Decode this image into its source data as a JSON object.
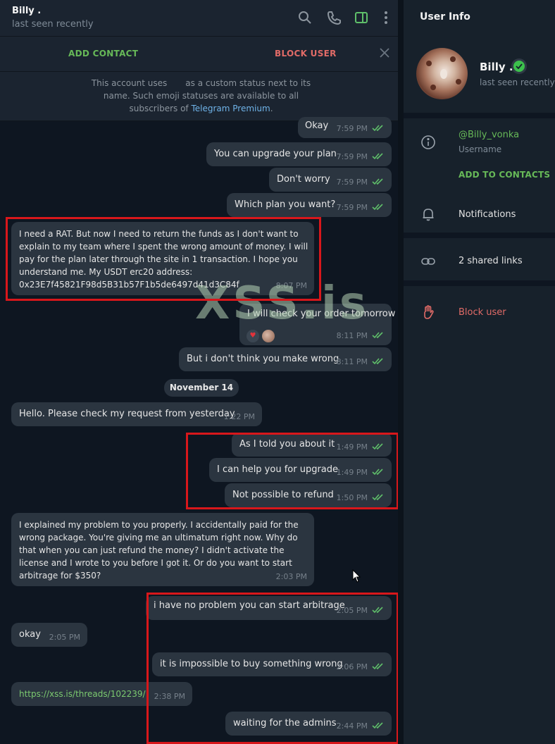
{
  "chat": {
    "name": "Billy .",
    "status": "last seen recently",
    "add_contact": "ADD CONTACT",
    "block_user": "BLOCK USER",
    "premium_note": {
      "line1a": "This account uses",
      "line1b": "as a custom status next to its",
      "line2": "name. Such emoji statuses are available to all",
      "line3a": "subscribers of",
      "link": "Telegram Premium",
      "line3b": "."
    },
    "date_divider": "November 14",
    "watermark": "XSS.is",
    "messages": [
      {
        "dir": "out",
        "text": "Okay",
        "time": "7:59 PM"
      },
      {
        "dir": "out",
        "text": "You can upgrade your plan",
        "time": "7:59 PM"
      },
      {
        "dir": "out",
        "text": "Don't worry",
        "time": "7:59 PM"
      },
      {
        "dir": "out",
        "text": "Which plan you want?",
        "time": "7:59 PM"
      },
      {
        "dir": "in",
        "text": "I need a RAT. But now I need to return the funds as I don't want to\nexplain to my team where I spent the wrong amount of money. I will\npay for the plan later through the site in 1 transaction. I hope you\nunderstand me. My USDT erc20 address:\n0x23E7f45821F98d5B31b57F1b5de6497d41d3C84f",
        "time": "8:07 PM"
      },
      {
        "dir": "out",
        "text": "I will check your order tomorrow",
        "time": "8:11 PM"
      },
      {
        "dir": "out",
        "text": "But i don't think you make wrong",
        "time": "8:11 PM"
      },
      {
        "dir": "in",
        "text": "Hello. Please check my request from yesterday",
        "time": "1:22 PM"
      },
      {
        "dir": "out",
        "text": "As I told you about it",
        "time": "1:49 PM"
      },
      {
        "dir": "out",
        "text": "I can help you for upgrade",
        "time": "1:49 PM"
      },
      {
        "dir": "out",
        "text": "Not possible to refund",
        "time": "1:50 PM"
      },
      {
        "dir": "in",
        "text": "I explained my problem to you properly. I accidentally paid for the\nwrong package. You're giving me an ultimatum right now. Why do\nthat when you can just refund the money? I didn't activate the\nlicense and I wrote to you before I got it. Or do you want to start\narbitrage for $350?",
        "time": "2:03 PM"
      },
      {
        "dir": "out",
        "text": "i have no problem you can start arbitrage",
        "time": "2:05 PM"
      },
      {
        "dir": "in",
        "text": "okay",
        "time": "2:05 PM"
      },
      {
        "dir": "out",
        "text": "it is impossible to buy something wrong",
        "time": "2:06 PM"
      },
      {
        "dir": "in",
        "text": "https://xss.is/threads/102239/",
        "time": "2:38 PM"
      },
      {
        "dir": "out",
        "text": "waiting for the admins",
        "time": "2:44 PM"
      }
    ]
  },
  "info": {
    "title": "User Info",
    "name": "Billy .",
    "status": "last seen recently",
    "username": "@Billy_vonka",
    "username_label": "Username",
    "add_to_contacts": "ADD TO CONTACTS",
    "notifications": "Notifications",
    "shared_links": "2 shared links",
    "block_user": "Block user"
  },
  "colors": {
    "accent_green": "#67b958",
    "danger_red": "#e16b67",
    "highlight_box": "#d8171b",
    "check_green": "#5fbf6a"
  }
}
